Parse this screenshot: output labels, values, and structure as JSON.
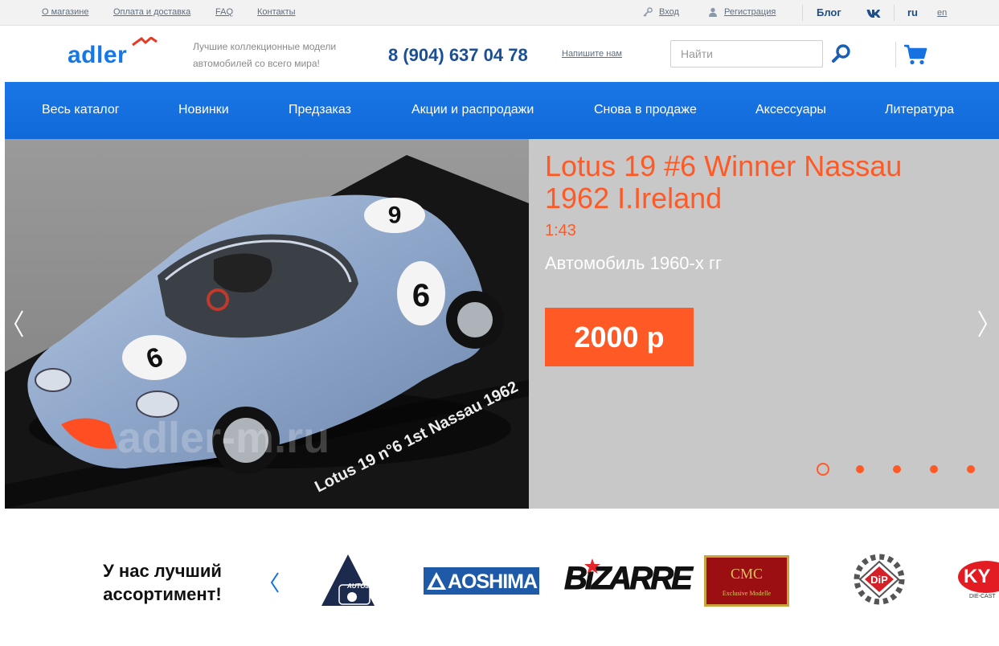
{
  "topbar": {
    "links": [
      "О магазине",
      "Оплата и доставка",
      "FAQ",
      "Контакты"
    ],
    "login": "Вход",
    "register": "Регистрация",
    "blog": "Блог",
    "vk": "vk",
    "lang_ru": "ru",
    "lang_en": "en"
  },
  "header": {
    "logo": "adler",
    "tagline": "Лучшие коллекционные модели автомобилей со всего мира!",
    "phone": "8 (904) 637 04 78",
    "write_us": "Напишите нам",
    "search_placeholder": "Найти"
  },
  "nav": {
    "items": [
      "Весь каталог",
      "Новинки",
      "Предзаказ",
      "Акции и распродажи",
      "Снова в продаже",
      "Аксессуары",
      "Литература"
    ]
  },
  "slider": {
    "title": "Lotus 19 #6 Winner Nassau 1962 I.Ireland",
    "scale": "1:43",
    "subtitle": "Автомобиль 1960-х гг",
    "price": "2000 р",
    "plate_text": "Lotus 19 n°6 1st Nassau 1962",
    "car_number": "6",
    "watermark": "adler-m.ru",
    "dots": 5,
    "active_dot": 1
  },
  "brands": {
    "title": "У нас лучший ассортимент!",
    "items": [
      {
        "name": "Autoart",
        "label": "AUTOart"
      },
      {
        "name": "Aoshima",
        "label": "AOSHIMA"
      },
      {
        "name": "Bizarre",
        "label": "BiZARRE"
      },
      {
        "name": "CMC",
        "label": "CMC",
        "sub": "Exclusive Modelle"
      },
      {
        "name": "DiP",
        "label": "DiP"
      },
      {
        "name": "Kyosho",
        "label": "KY",
        "sub": "DIE-CAST"
      }
    ]
  },
  "colors": {
    "accent": "#ff5a26",
    "nav": "#1672e0",
    "phone": "#1b4f95"
  }
}
